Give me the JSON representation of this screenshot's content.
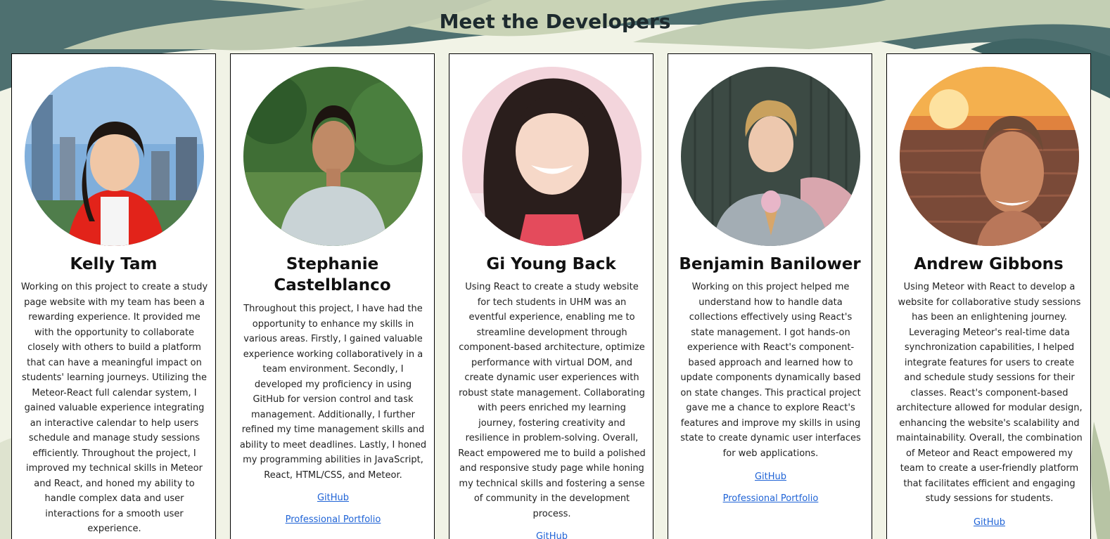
{
  "page": {
    "title": "Meet the Developers"
  },
  "developers": [
    {
      "name": "Kelly Tam",
      "bio": "Working on this project to create a study page website with my team has been a rewarding experience. It provided me with the opportunity to collaborate closely with others to build a platform that can have a meaningful impact on students' learning journeys. Utilizing the Meteor-React full calendar system, I gained valuable experience integrating an interactive calendar to help users schedule and manage study sessions efficiently. Throughout the project, I improved my technical skills in Meteor and React, and honed my ability to handle complex data and user interactions for a smooth user experience.",
      "links": []
    },
    {
      "name": "Stephanie Castelblanco",
      "bio": "Throughout this project, I have had the opportunity to enhance my skills in various areas. Firstly, I gained valuable experience working collaboratively in a team environment. Secondly, I developed my proficiency in using GitHub for version control and task management. Additionally, I further refined my time management skills and ability to meet deadlines. Lastly, I honed my programming abilities in JavaScript, React, HTML/CSS, and Meteor.",
      "links": [
        {
          "label": "GitHub"
        },
        {
          "label": "Professional Portfolio"
        }
      ]
    },
    {
      "name": "Gi Young Back",
      "bio": "Using React to create a study website for tech students in UHM was an eventful experience, enabling me to streamline development through component-based architecture, optimize performance with virtual DOM, and create dynamic user experiences with robust state management. Collaborating with peers enriched my learning journey, fostering creativity and resilience in problem-solving. Overall, React empowered me to build a polished and responsive study page while honing my technical skills and fostering a sense of community in the development process.",
      "links": [
        {
          "label": "GitHub"
        }
      ]
    },
    {
      "name": "Benjamin Banilower",
      "bio": "Working on this project helped me understand how to handle data collections effectively using React's state management. I got hands-on experience with React's component-based approach and learned how to update components dynamically based on state changes. This practical project gave me a chance to explore React's features and improve my skills in using state to create dynamic user interfaces for web applications.",
      "links": [
        {
          "label": "GitHub"
        },
        {
          "label": "Professional Portfolio"
        }
      ]
    },
    {
      "name": "Andrew Gibbons",
      "bio": "Using Meteor with React to develop a website for collaborative study sessions has been an enlightening journey. Leveraging Meteor's real-time data synchronization capabilities, I helped integrate features for users to create and schedule study sessions for their classes. React's component-based architecture allowed for modular design, enhancing the website's scalability and maintainability. Overall, the combination of Meteor and React empowered my team to create a user-friendly platform that facilitates efficient and engaging study sessions for students.",
      "links": [
        {
          "label": "GitHub"
        }
      ]
    }
  ]
}
